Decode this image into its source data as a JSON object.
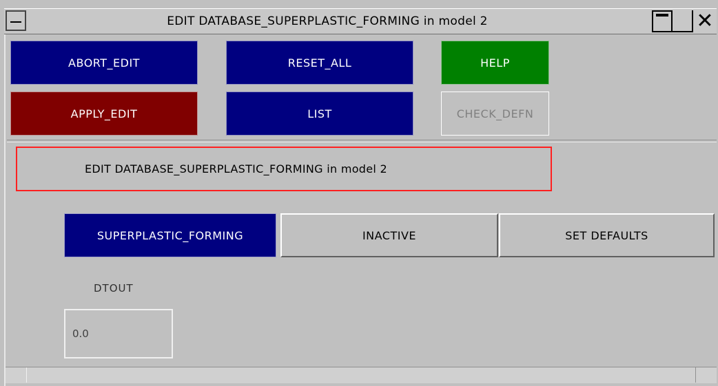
{
  "window": {
    "title": "EDIT DATABASE_SUPERPLASTIC_FORMING in model 2",
    "close_glyph": "✕"
  },
  "toolbar": {
    "abort_edit": "ABORT_EDIT",
    "reset_all": "RESET_ALL",
    "help": "HELP",
    "apply_edit": "APPLY_EDIT",
    "list": "LIST",
    "check_defn": "CHECK_DEFN"
  },
  "header": {
    "text": "EDIT DATABASE_SUPERPLASTIC_FORMING in model 2"
  },
  "tabs": [
    {
      "label": "SUPERPLASTIC_FORMING",
      "active": true
    },
    {
      "label": "INACTIVE",
      "active": false
    },
    {
      "label": "SET DEFAULTS",
      "active": false
    }
  ],
  "fields": {
    "dtout": {
      "label": "DTOUT",
      "value": "0.0"
    }
  },
  "colors": {
    "blue": "#000080",
    "red": "#800000",
    "green": "#008000",
    "panel": "#c0c0c0",
    "highlight_border": "#ff2020"
  }
}
